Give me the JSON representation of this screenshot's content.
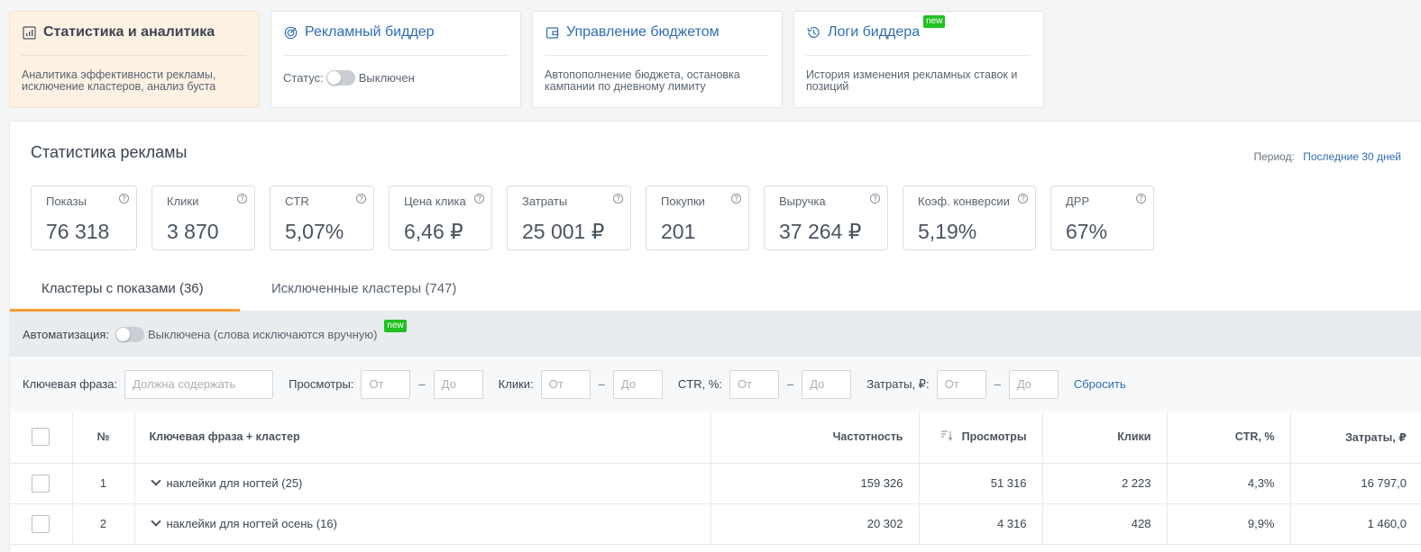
{
  "nav_cards": [
    {
      "title": "Статистика и аналитика",
      "desc": "Аналитика эффективности рекламы, исключение кластеров, анализ буста"
    },
    {
      "title": "Рекламный биддер",
      "status_label": "Статус:",
      "status_value": "Выключен"
    },
    {
      "title": "Управление бюджетом",
      "desc": "Автопополнение бюджета, остановка кампании по дневному лимиту"
    },
    {
      "title": "Логи биддера",
      "badge": "new",
      "desc": "История изменения рекламных ставок и позиций"
    }
  ],
  "panel": {
    "title": "Статистика рекламы",
    "period_label": "Период:",
    "period_value": "Последние 30 дней"
  },
  "kpis": [
    {
      "label": "Показы",
      "value": "76 318"
    },
    {
      "label": "Клики",
      "value": "3 870"
    },
    {
      "label": "CTR",
      "value": "5,07%"
    },
    {
      "label": "Цена клика",
      "value": "6,46 ₽"
    },
    {
      "label": "Затраты",
      "value": "25 001 ₽"
    },
    {
      "label": "Покупки",
      "value": "201"
    },
    {
      "label": "Выручка",
      "value": "37 264 ₽"
    },
    {
      "label": "Коэф. конверсии",
      "value": "5,19%"
    },
    {
      "label": "ДРР",
      "value": "67%"
    }
  ],
  "help_glyph": "?",
  "tabs": [
    {
      "label": "Кластеры с показами (36)"
    },
    {
      "label": "Исключенные кластеры (747)"
    }
  ],
  "automation": {
    "label": "Автоматизация:",
    "value": "Выключена (слова исключаются вручную)",
    "badge": "new"
  },
  "filters": {
    "keyword_label": "Ключевая фраза:",
    "keyword_placeholder": "Должна содержать",
    "views_label": "Просмотры:",
    "clicks_label": "Клики:",
    "ctr_label": "CTR, %:",
    "cost_label": "Затраты, ₽:",
    "from": "От",
    "to": "До",
    "dash": "–",
    "reset": "Сбросить"
  },
  "table": {
    "headers": {
      "num": "№",
      "phrase": "Ключевая фраза + кластер",
      "freq": "Частотность",
      "views": "Просмотры",
      "clicks": "Клики",
      "ctr": "CTR, %",
      "cost": "Затраты, ₽"
    },
    "rows": [
      {
        "num": "1",
        "phrase": "наклейки для ногтей (25)",
        "freq": "159 326",
        "views": "51 316",
        "clicks": "2 223",
        "ctr": "4,3%",
        "cost": "16 797,0"
      },
      {
        "num": "2",
        "phrase": "наклейки для ногтей осень (16)",
        "freq": "20 302",
        "views": "4 316",
        "clicks": "428",
        "ctr": "9,9%",
        "cost": "1 460,0"
      }
    ]
  }
}
